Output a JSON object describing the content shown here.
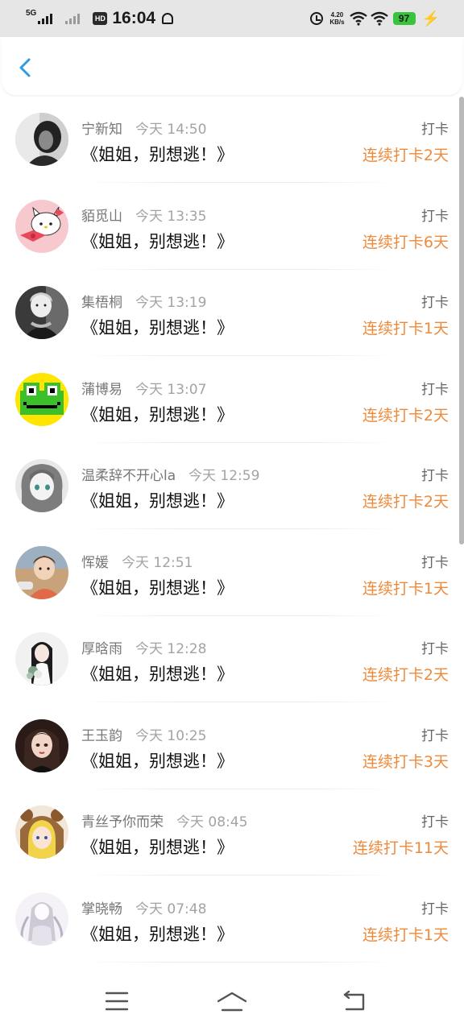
{
  "status_bar": {
    "network": "5G",
    "hd": "HD",
    "time": "16:04",
    "speed_value": "4.20",
    "speed_unit": "KB/s",
    "battery": "97",
    "icons": [
      "signal-icon",
      "hd-icon",
      "alarm-icon",
      "wifi-icon",
      "battery-icon",
      "charging-icon"
    ]
  },
  "header": {
    "back_icon": "back-arrow-icon"
  },
  "colors": {
    "accent_blue": "#2f9be0",
    "streak_orange": "#f08a3b",
    "battery_green": "#38c43c"
  },
  "scroll": {
    "thumb_fraction": 0.5
  },
  "entries": [
    {
      "user": "宁新知",
      "time": "今天 14:50",
      "title": "《姐姐，别想逃！》",
      "tag": "打卡",
      "streak": "连续打卡2天",
      "avatar": "girl-bw-portrait"
    },
    {
      "user": "貊觅山",
      "time": "今天 13:35",
      "title": "《姐姐，别想逃！》",
      "tag": "打卡",
      "streak": "连续打卡6天",
      "avatar": "hello-kitty-cartoon"
    },
    {
      "user": "集梧桐",
      "time": "今天 13:19",
      "title": "《姐姐，别想逃！》",
      "tag": "打卡",
      "streak": "连续打卡1天",
      "avatar": "child-bw-photo"
    },
    {
      "user": "蒲博易",
      "time": "今天 13:07",
      "title": "《姐姐，别想逃！》",
      "tag": "打卡",
      "streak": "连续打卡2天",
      "avatar": "pixel-frog"
    },
    {
      "user": "温柔辞不开心la",
      "time": "今天 12:59",
      "title": "《姐姐，别想逃！》",
      "tag": "打卡",
      "streak": "连续打卡2天",
      "avatar": "anime-girl-sketch"
    },
    {
      "user": "恽媛",
      "time": "今天 12:51",
      "title": "《姐姐，别想逃！》",
      "tag": "打卡",
      "streak": "连续打卡1天",
      "avatar": "toddler-photo"
    },
    {
      "user": "厚晗雨",
      "time": "今天 12:28",
      "title": "《姐姐，别想逃！》",
      "tag": "打卡",
      "streak": "连续打卡2天",
      "avatar": "girl-with-flowers"
    },
    {
      "user": "王玉韵",
      "time": "今天 10:25",
      "title": "《姐姐，别想逃！》",
      "tag": "打卡",
      "streak": "连续打卡3天",
      "avatar": "illustrated-girl"
    },
    {
      "user": "青丝予你而荣",
      "time": "今天 08:45",
      "title": "《姐姐，别想逃！》",
      "tag": "打卡",
      "streak": "连续打卡11天",
      "avatar": "anime-bear-hood"
    },
    {
      "user": "掌晓畅",
      "time": "今天 07:48",
      "title": "《姐姐，别想逃！》",
      "tag": "打卡",
      "streak": "连续打卡1天",
      "avatar": "long-hair-drawing"
    }
  ],
  "nav_bar": {
    "icons": [
      "menu-icon",
      "home-icon",
      "back-icon"
    ]
  }
}
